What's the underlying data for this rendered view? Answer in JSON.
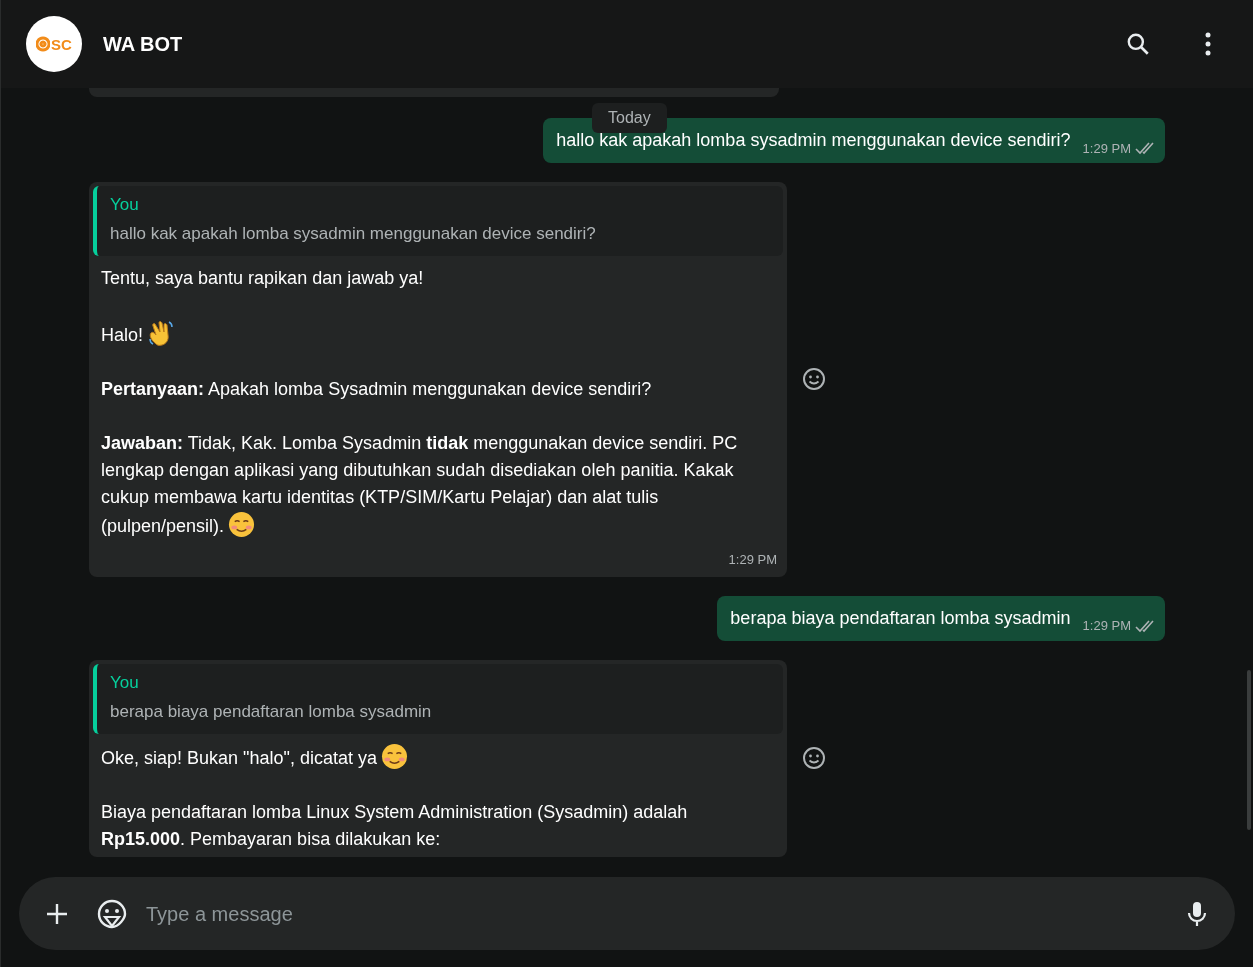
{
  "header": {
    "logo_text": "SC",
    "title": "WA BOT"
  },
  "date_chip": "Today",
  "messages": [
    {
      "kind": "outgoing",
      "text": "hallo kak apakah lomba sysadmin menggunakan device sendiri?",
      "time": "1:29 PM",
      "read": false
    },
    {
      "kind": "incoming",
      "quote": {
        "author": "You",
        "text": "hallo kak apakah lomba sysadmin menggunakan device sendiri?"
      },
      "paragraphs": [
        {
          "kind": "plain",
          "text": "Tentu, saya bantu rapikan dan jawab ya!"
        },
        {
          "kind": "wave",
          "text": "Halo!"
        },
        {
          "kind": "plain",
          "text": "**Pertanyaan:** Apakah lomba Sysadmin menggunakan device sendiri?"
        },
        {
          "kind": "smile",
          "text": "**Jawaban:** Tidak, Kak. Lomba Sysadmin **tidak** menggunakan device sendiri. PC lengkap dengan aplikasi yang dibutuhkan sudah disediakan oleh panitia. Kakak cukup membawa kartu identitas (KTP/SIM/Kartu Pelajar) dan alat tulis (pulpen/pensil)."
        }
      ],
      "time": "1:29 PM"
    },
    {
      "kind": "outgoing",
      "text": "berapa biaya pendaftaran lomba sysadmin",
      "time": "1:29 PM",
      "read": false
    },
    {
      "kind": "incoming",
      "quote": {
        "author": "You",
        "text": "berapa biaya pendaftaran lomba sysadmin"
      },
      "paragraphs": [
        {
          "kind": "smile",
          "text": "Oke, siap! Bukan \"halo\", dicatat ya"
        },
        {
          "kind": "plain",
          "text": "Biaya pendaftaran lomba Linux System Administration (Sysadmin) adalah **Rp15.000**. Pembayaran bisa dilakukan ke:"
        }
      ]
    }
  ],
  "composer": {
    "placeholder": "Type a message"
  }
}
